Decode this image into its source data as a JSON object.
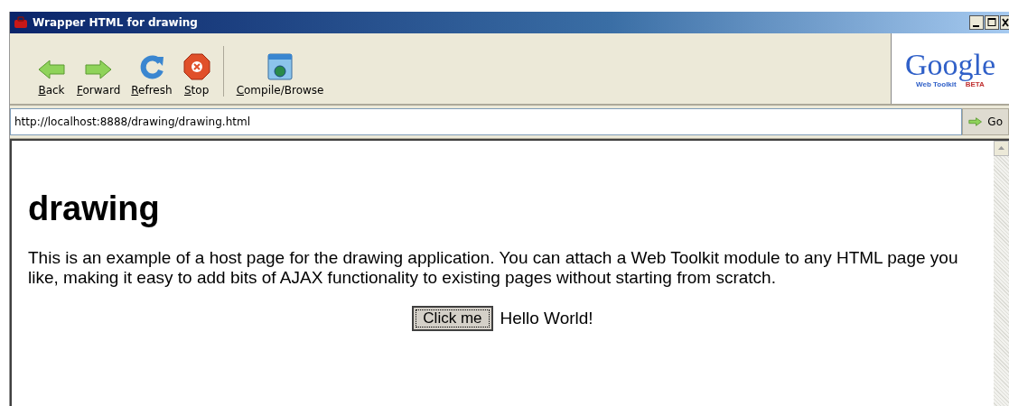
{
  "window": {
    "title": "Wrapper HTML for drawing"
  },
  "toolbar": {
    "buttons": [
      {
        "kind": "back",
        "label": "Back"
      },
      {
        "kind": "forward",
        "label": "Forward"
      },
      {
        "kind": "refresh",
        "label": "Refresh"
      },
      {
        "kind": "stop",
        "label": "Stop"
      },
      {
        "kind": "compile",
        "label": "Compile/Browse"
      }
    ],
    "logo": {
      "name": "Google",
      "subtitle": "Web Toolkit",
      "badge": "BETA"
    }
  },
  "address_bar": {
    "value": "http://localhost:8888/drawing/drawing.html",
    "go_button": "Go"
  },
  "page": {
    "heading": "drawing",
    "paragraph": "This is an example of a host page for the drawing application. You can attach a Web Toolkit module to any HTML page you like, making it easy to add bits of AJAX functionality to existing pages without starting from scratch.",
    "button": "Click me",
    "message": "Hello World!"
  }
}
